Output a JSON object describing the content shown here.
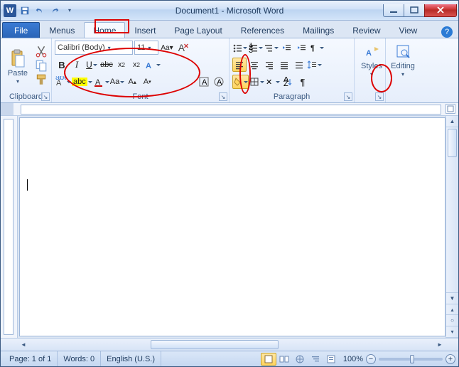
{
  "titlebar": {
    "title": "Document1 - Microsoft Word"
  },
  "tabs": {
    "file": "File",
    "menus": "Menus",
    "home": "Home",
    "insert": "Insert",
    "page_layout": "Page Layout",
    "references": "References",
    "mailings": "Mailings",
    "review": "Review",
    "view": "View"
  },
  "clipboard": {
    "paste": "Paste",
    "label": "Clipboard"
  },
  "font": {
    "family": "Calibri (Body)",
    "size": "11",
    "label": "Font",
    "bold": "B",
    "italic": "I",
    "underline": "U",
    "strike": "abc",
    "sub": "x",
    "sup": "x",
    "abc": "abc",
    "aa": "Aa",
    "grow": "A",
    "shrink": "A"
  },
  "paragraph": {
    "label": "Paragraph"
  },
  "styles": {
    "label": "Styles"
  },
  "editing": {
    "label": "Editing"
  },
  "status": {
    "page": "Page: 1 of 1",
    "words": "Words: 0",
    "lang": "English (U.S.)",
    "zoom": "100%"
  }
}
